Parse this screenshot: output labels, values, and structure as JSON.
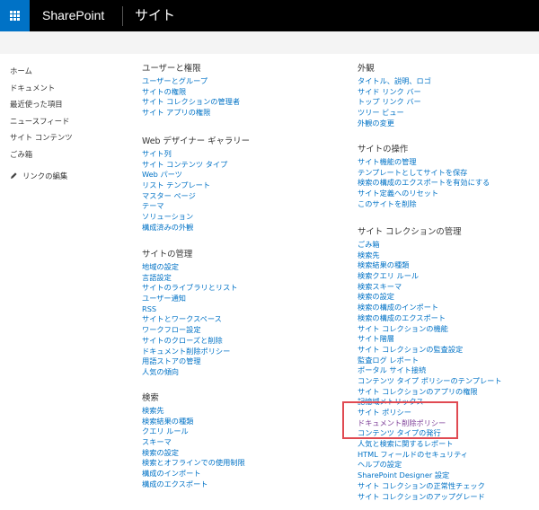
{
  "header": {
    "brand": "SharePoint",
    "title": "サイト",
    "waffle_icon": "waffle-grid-icon"
  },
  "quick_launch": {
    "items": [
      "ホーム",
      "ドキュメント",
      "最近使った項目",
      "ニュースフィード",
      "サイト コンテンツ",
      "ごみ箱"
    ],
    "edit_label": "リンクの編集",
    "edit_icon": "pencil-icon"
  },
  "sections": {
    "users": {
      "title": "ユーザーと権限",
      "links": [
        "ユーザーとグループ",
        "サイトの権限",
        "サイト コレクションの管理者",
        "サイト アプリの権限"
      ]
    },
    "designer": {
      "title": "Web デザイナー ギャラリー",
      "links": [
        "サイト列",
        "サイト コンテンツ タイプ",
        "Web パーツ",
        "リスト テンプレート",
        "マスター ページ",
        "テーマ",
        "ソリューション",
        "構成済みの外観"
      ]
    },
    "site_admin": {
      "title": "サイトの管理",
      "links": [
        "地域の設定",
        "言語設定",
        "サイトのライブラリとリスト",
        "ユーザー通知",
        "RSS",
        "サイトとワークスペース",
        "ワークフロー設定",
        "サイトのクローズと削除",
        "ドキュメント削除ポリシー",
        "用語ストアの管理",
        "人気の傾向"
      ]
    },
    "search": {
      "title": "検索",
      "links": [
        "検索先",
        "検索結果の種類",
        "クエリ ルール",
        "スキーマ",
        "検索の設定",
        "検索とオフラインでの使用制限",
        "構成のインポート",
        "構成のエクスポート"
      ]
    },
    "look": {
      "title": "外観",
      "links": [
        "タイトル、説明、ロゴ",
        "サイド リンク バー",
        "トップ リンク バー",
        "ツリー ビュー",
        "外観の変更"
      ]
    },
    "actions": {
      "title": "サイトの操作",
      "links": [
        "サイト機能の管理",
        "テンプレートとしてサイトを保存",
        "検索の構成のエクスポートを有効にする",
        "サイト定義へのリセット",
        "このサイトを削除"
      ]
    },
    "collection": {
      "title": "サイト コレクションの管理",
      "links": [
        "ごみ箱",
        "検索先",
        "検索結果の種類",
        "検索クエリ ルール",
        "検索スキーマ",
        "検索の設定",
        "検索の構成のインポート",
        "検索の構成のエクスポート",
        "サイト コレクションの機能",
        "サイト階層",
        "サイト コレクションの監査設定",
        "監査ログ レポート",
        "ポータル サイト接続",
        "コンテンツ タイプ ポリシーのテンプレート",
        "サイト コレクションのアプリの権限",
        "記憶域メトリックス",
        "サイト ポリシー",
        "ドキュメント削除ポリシー",
        "コンテンツ タイプの発行",
        "人気と検索に関するレポート",
        "HTML フィールドのセキュリティ",
        "ヘルプの設定",
        "SharePoint Designer 設定",
        "サイト コレクションの正常性チェック",
        "サイト コレクションのアップグレード"
      ]
    }
  },
  "colors": {
    "link": "#0072c6",
    "visited": "#7e3f98",
    "highlight": "#e04a52",
    "waffle": "#0072c6"
  }
}
